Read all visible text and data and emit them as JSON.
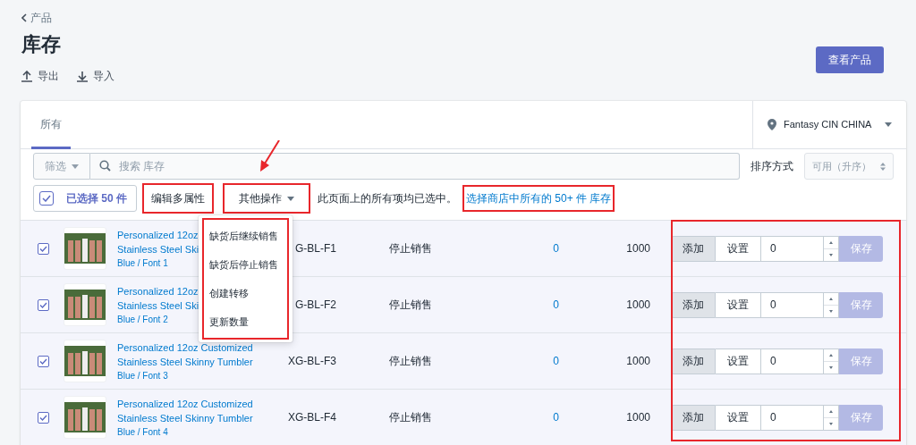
{
  "breadcrumb": "产品",
  "title": "库存",
  "actions": [
    {
      "kind": "export",
      "label": "导出"
    },
    {
      "kind": "import",
      "label": "导入"
    }
  ],
  "primary_button": "查看产品",
  "tabs": [
    {
      "label": "所有",
      "selected": true
    }
  ],
  "location": "Fantasy CIN CHINA",
  "filter": {
    "label": "筛选",
    "placeholder": "搜索 库存"
  },
  "sort": {
    "label": "排序方式",
    "value": "可用（升序）"
  },
  "bulk": {
    "checked": true,
    "count": "已选择 50 件",
    "edit_button": {
      "label": "编辑多属性",
      "highlighted": true
    },
    "more_button": {
      "label": "其他操作",
      "highlighted": true
    },
    "notice": "此页面上的所有项均已选中。",
    "select_all_link": {
      "label": "选择商店中所有的 50+ 件 库存",
      "highlighted": true
    }
  },
  "menu": {
    "highlighted": true,
    "items": [
      "缺货后继续销售",
      "缺货后停止销售",
      "创建转移",
      "更新数量"
    ]
  },
  "rows": [
    {
      "selected": true,
      "name": [
        "Personalized 12oz",
        "Stainless Steel Ski"
      ],
      "variant": "Blue / Font 1",
      "sku": "G-BL-F1",
      "status": "停止销售",
      "committed": "0",
      "available": "1000",
      "add": "添加",
      "set": "设置",
      "quantity": "0",
      "save": "保存"
    },
    {
      "selected": true,
      "name": [
        "Personalized 12oz",
        "Stainless Steel Ski"
      ],
      "variant": "Blue / Font 2",
      "sku": "G-BL-F2",
      "status": "停止销售",
      "committed": "0",
      "available": "1000",
      "add": "添加",
      "set": "设置",
      "quantity": "0",
      "save": "保存"
    },
    {
      "selected": true,
      "name": [
        "Personalized 12oz Customized",
        "Stainless Steel Skinny Tumbler"
      ],
      "variant": "Blue / Font 3",
      "sku": "XG-BL-F3",
      "status": "停止销售",
      "committed": "0",
      "available": "1000",
      "add": "添加",
      "set": "设置",
      "quantity": "0",
      "save": "保存"
    },
    {
      "selected": true,
      "name": [
        "Personalized 12oz Customized",
        "Stainless Steel Skinny Tumbler"
      ],
      "variant": "Blue / Font 4",
      "sku": "XG-BL-F4",
      "status": "停止销售",
      "committed": "0",
      "available": "1000",
      "add": "添加",
      "set": "设置",
      "quantity": "0",
      "save": "保存"
    }
  ],
  "controls_highlighted": true
}
